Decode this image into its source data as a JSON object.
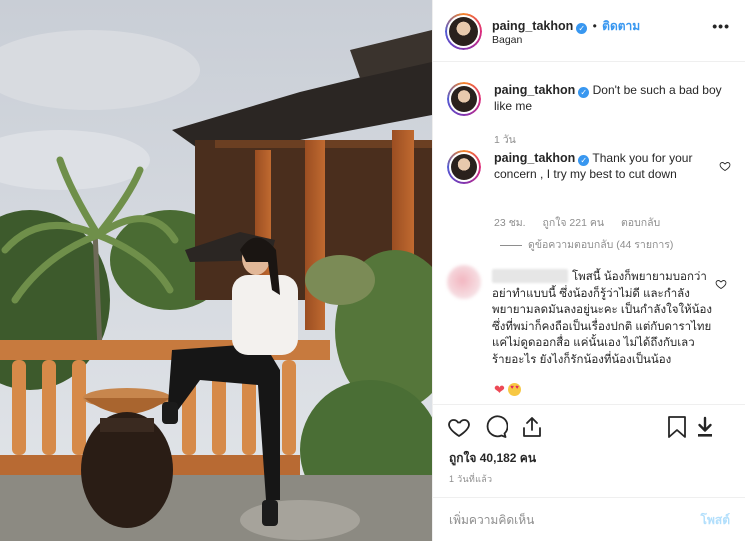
{
  "post": {
    "author": "paing_takhon",
    "follow_label": "ติดตาม",
    "location": "Bagan",
    "more_icon": "ellipsis-icon"
  },
  "caption": {
    "author": "paing_takhon",
    "text": "Don't be such a bad boy like me",
    "age": "1 วัน"
  },
  "reply": {
    "author": "paing_takhon",
    "text": "Thank you for your concern , I try my best to cut down",
    "age": "23 ชม.",
    "likes": "ถูกใจ 221 คน",
    "reply_label": "ตอบกลับ",
    "view_replies": "ดูข้อความตอบกลับ (44 รายการ)"
  },
  "fan_comment": {
    "text": "โพสนี้ น้องก็พยายามบอกว่า อย่าทำแบบนี้ ซึ่งน้องก็รู้ว่าไม่ดี และกำลังพยายามลดมันลงอยู่นะคะ เป็นกำลังใจให้น้อง ซึ่งที่พม่าก็คงถือเป็นเรื่องปกติ แต่กับดาราไทยแค่ไม่ดูดออกสื่อ แค่นั้นเอง ไม่ได้ถึงกับเลวร้ายอะไร ยังไงก็รักน้องที่น้องเป็นน้อง",
    "emojis": [
      "red-heart-emoji",
      "heart-eyes-emoji"
    ]
  },
  "actions": {
    "like_icon": "heart-icon",
    "comment_icon": "comment-icon",
    "share_icon": "share-icon",
    "save_icon": "bookmark-icon",
    "download_icon": "download-icon"
  },
  "likes_count": "ถูกใจ 40,182 คน",
  "posted_time": "1 วันที่แล้ว",
  "add_comment": {
    "placeholder": "เพิ่มความคิดเห็น",
    "post_label": "โพสต์"
  },
  "colors": {
    "link_blue": "#3897f0",
    "muted": "#8e8e8e",
    "post_disabled": "#b2dffc",
    "heart_red": "#ed4956"
  }
}
